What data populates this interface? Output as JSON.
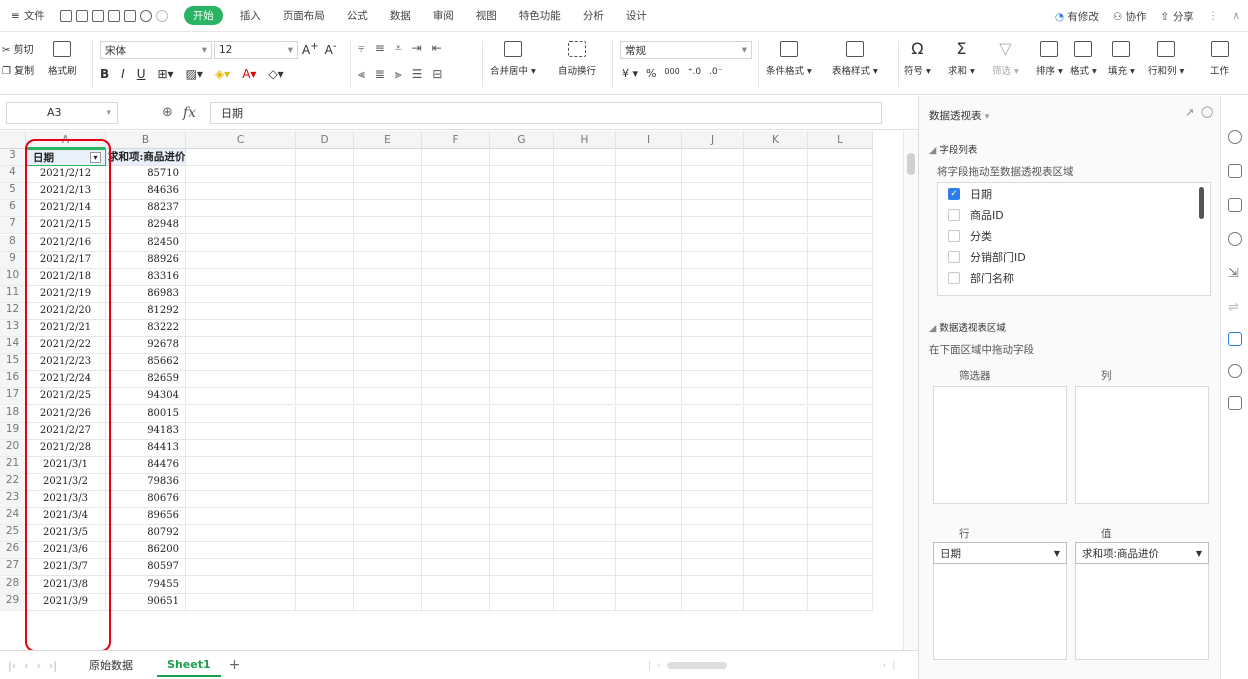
{
  "menu": {
    "hamburger": "≡",
    "file": "文件",
    "tabs": [
      "开始",
      "插入",
      "页面布局",
      "公式",
      "数据",
      "审阅",
      "视图",
      "特色功能",
      "分析",
      "设计"
    ],
    "active_tab": "开始",
    "right": [
      "有修改",
      "协作",
      "分享"
    ]
  },
  "ribbon": {
    "cut": "剪切",
    "copy": "复制",
    "format_painter": "格式刷",
    "font_name": "宋体",
    "font_size": "12",
    "merge_center": "合并居中",
    "wrap_text": "自动换行",
    "number_format": "常规",
    "currency": "¥",
    "percent": "%",
    "thousands": "000",
    "conditional_format": "条件格式",
    "table_style": "表格样式",
    "symbol": "符号",
    "sum": "求和",
    "filter": "筛选",
    "sort": "排序",
    "format": "格式",
    "fill": "填充",
    "rows_cols": "行和列",
    "worksheet": "工作"
  },
  "formula_bar": {
    "name_box": "A3",
    "fx": "fx",
    "content": "日期"
  },
  "columns": [
    "A",
    "B",
    "C",
    "D",
    "E",
    "F",
    "G",
    "H",
    "I",
    "J",
    "K",
    "L"
  ],
  "header_row": {
    "row": "3",
    "a": "日期",
    "b": "求和项:商品进价"
  },
  "rows": [
    {
      "n": "4",
      "date": "2021/2/12",
      "value": "85710"
    },
    {
      "n": "5",
      "date": "2021/2/13",
      "value": "84636"
    },
    {
      "n": "6",
      "date": "2021/2/14",
      "value": "88237"
    },
    {
      "n": "7",
      "date": "2021/2/15",
      "value": "82948"
    },
    {
      "n": "8",
      "date": "2021/2/16",
      "value": "82450"
    },
    {
      "n": "9",
      "date": "2021/2/17",
      "value": "88926"
    },
    {
      "n": "10",
      "date": "2021/2/18",
      "value": "83316"
    },
    {
      "n": "11",
      "date": "2021/2/19",
      "value": "86983"
    },
    {
      "n": "12",
      "date": "2021/2/20",
      "value": "81292"
    },
    {
      "n": "13",
      "date": "2021/2/21",
      "value": "83222"
    },
    {
      "n": "14",
      "date": "2021/2/22",
      "value": "92678"
    },
    {
      "n": "15",
      "date": "2021/2/23",
      "value": "85662"
    },
    {
      "n": "16",
      "date": "2021/2/24",
      "value": "82659"
    },
    {
      "n": "17",
      "date": "2021/2/25",
      "value": "94304"
    },
    {
      "n": "18",
      "date": "2021/2/26",
      "value": "80015"
    },
    {
      "n": "19",
      "date": "2021/2/27",
      "value": "94183"
    },
    {
      "n": "20",
      "date": "2021/2/28",
      "value": "84413"
    },
    {
      "n": "21",
      "date": "2021/3/1",
      "value": "84476"
    },
    {
      "n": "22",
      "date": "2021/3/2",
      "value": "79836"
    },
    {
      "n": "23",
      "date": "2021/3/3",
      "value": "80676"
    },
    {
      "n": "24",
      "date": "2021/3/4",
      "value": "89656"
    },
    {
      "n": "25",
      "date": "2021/3/5",
      "value": "80792"
    },
    {
      "n": "26",
      "date": "2021/3/6",
      "value": "86200"
    },
    {
      "n": "27",
      "date": "2021/3/7",
      "value": "80597"
    },
    {
      "n": "28",
      "date": "2021/3/8",
      "value": "79455"
    },
    {
      "n": "29",
      "date": "2021/3/9",
      "value": "90651"
    }
  ],
  "sheets": {
    "tabs": [
      "原始数据",
      "Sheet1"
    ],
    "active": "Sheet1",
    "add": "+"
  },
  "pivot_pane": {
    "title": "数据透视表",
    "field_list_title": "字段列表",
    "field_list_hint": "将字段拖动至数据透视表区域",
    "fields": [
      {
        "label": "日期",
        "checked": true
      },
      {
        "label": "商品ID",
        "checked": false
      },
      {
        "label": "分类",
        "checked": false
      },
      {
        "label": "分销部门ID",
        "checked": false
      },
      {
        "label": "部门名称",
        "checked": false
      }
    ],
    "area_title": "数据透视表区域",
    "area_hint": "在下面区域中拖动字段",
    "filter_label": "筛选器",
    "column_label": "列",
    "row_label": "行",
    "value_label": "值",
    "row_field": "日期",
    "value_field": "求和项:商品进价"
  },
  "colors": {
    "accent": "#28b463",
    "highlight": "#e60012",
    "checkbox": "#2b7de9"
  }
}
